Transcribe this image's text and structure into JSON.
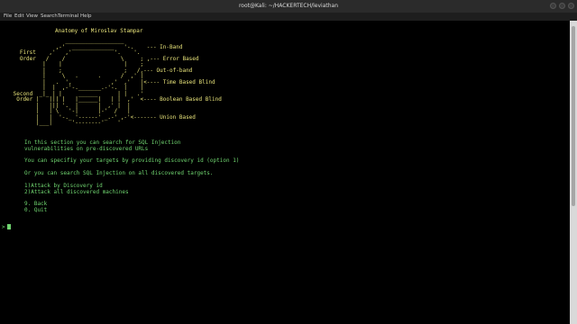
{
  "window": {
    "title": "root@Kali: ~/HACKERTECH/leviathan"
  },
  "menu": [
    "File",
    "Edit",
    "View",
    "Search",
    "Terminal",
    "Help"
  ],
  "terminal": {
    "heading": "Anatomy of Miroslav Stampar",
    "ascii_art": "                 __________________\n              ,-'  _____________   '-.    --- In-Band\n   First    ,'   ,'             '.    '.\n   Order   /    /                 \\     ; ,--- Error Based\n          |    |                   |    ;\n          |    ;                   ;   /,--- Out-of-band\n          |     \\   .      .      /  ,' |\n          |   .  ',            ,'  ,'   |<---- Time Based Blind\n          |  |  ,-'-._______.-'-.  |    |\n Second  _|_ | |     ______      | |   .'\n  Order |   ||| |   |______|   | |  ,'  <---- Boolean Based Blind\n        |   ||| '.  |      |  ,' |  |\n        |   | \\   '-|      |-'  /   |\n        |   |  '-._ '------' _.-' ,-'<------- Union Based\n        |___|      '--------'    '",
    "intro_1": "In this section you can search for SQL Injection",
    "intro_2": "vulnerabilities on pre-discovered URLs",
    "option_line": "You can specifiy your targets by providing discovery id (option 1)",
    "or_line": "Or you can search SQL Injection on all discovered targets.",
    "menu_options": [
      "1)Attack by Discovery id",
      "2)Attack all discovered machines"
    ],
    "back": "9. Back",
    "quit": "0. Quit",
    "prompt": ">"
  }
}
